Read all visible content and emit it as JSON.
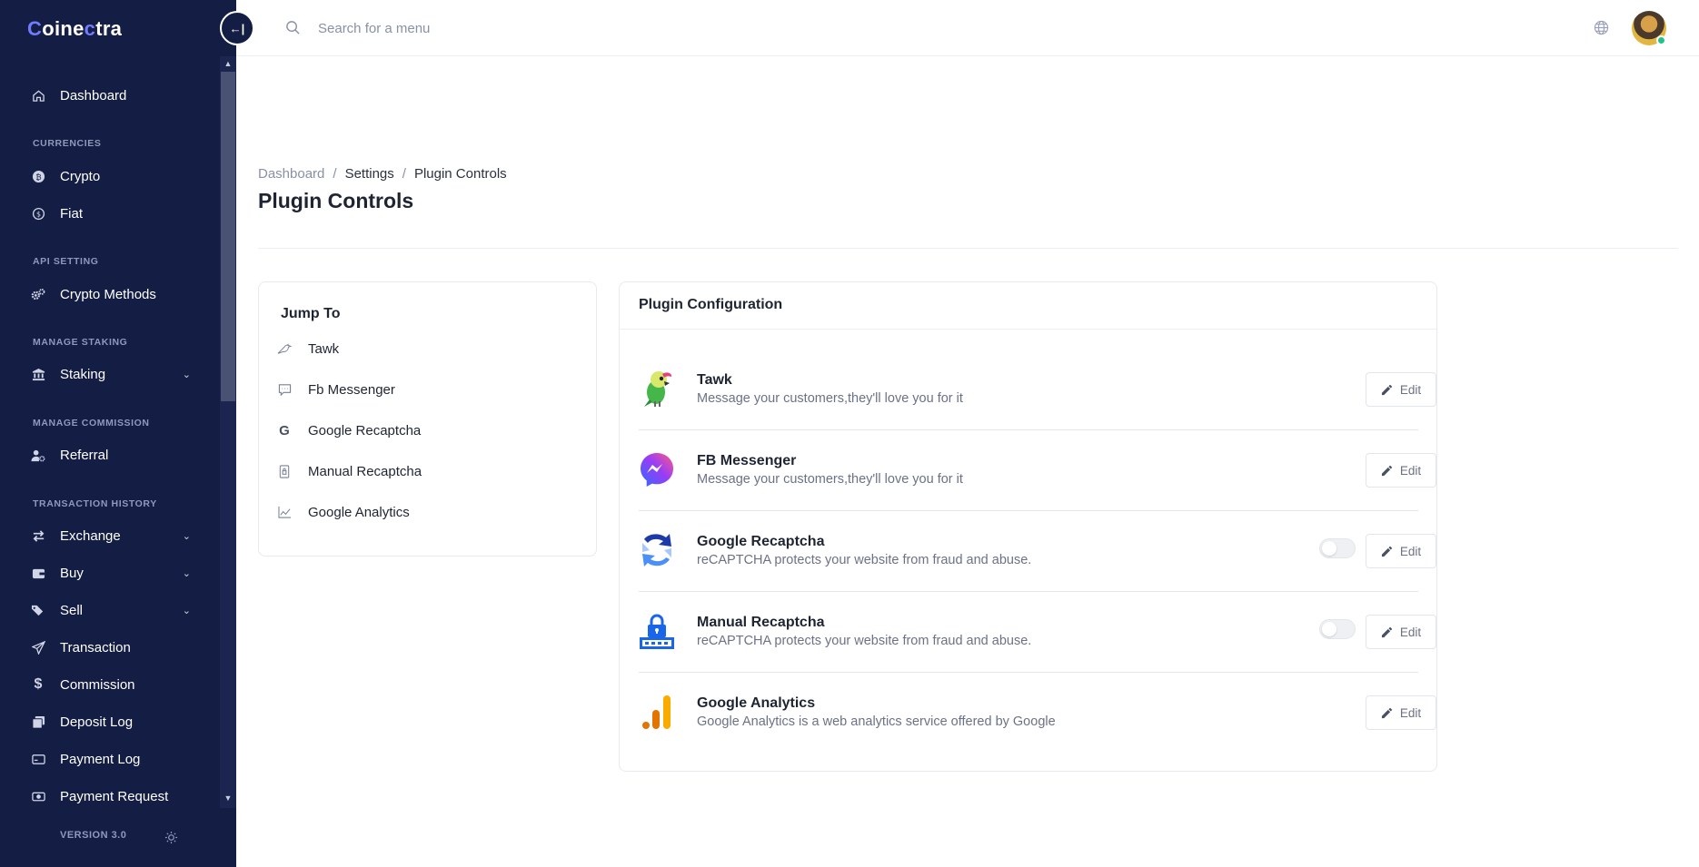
{
  "app": {
    "logo_first": "C",
    "logo_mid": "oine",
    "logo_accent": "c",
    "logo_last": "tra",
    "version": "VERSION 3.0"
  },
  "sidebar": {
    "dashboard": "Dashboard",
    "sections": {
      "currencies": "CURRENCIES",
      "api_setting": "API SETTING",
      "manage_staking": "MANAGE STAKING",
      "manage_commission": "MANAGE COMMISSION",
      "transaction_history": "TRANSACTION HISTORY"
    },
    "items": {
      "crypto": "Crypto",
      "fiat": "Fiat",
      "crypto_methods": "Crypto Methods",
      "staking": "Staking",
      "referral": "Referral",
      "exchange": "Exchange",
      "buy": "Buy",
      "sell": "Sell",
      "transaction": "Transaction",
      "commission": "Commission",
      "deposit_log": "Deposit Log",
      "payment_log": "Payment Log",
      "payment_request": "Payment Request"
    }
  },
  "topbar": {
    "search_placeholder": "Search for a menu"
  },
  "breadcrumb": {
    "home": "Dashboard",
    "settings": "Settings",
    "current": "Plugin Controls",
    "separator": "/"
  },
  "page": {
    "title": "Plugin Controls"
  },
  "jump": {
    "title": "Jump To",
    "items": [
      "Tawk",
      "Fb Messenger",
      "Google Recaptcha",
      "Manual Recaptcha",
      "Google Analytics"
    ]
  },
  "plugins": {
    "title": "Plugin Configuration",
    "edit_label": "Edit",
    "rows": [
      {
        "name": "Tawk",
        "desc": "Message your customers,they'll love you for it"
      },
      {
        "name": "FB Messenger",
        "desc": "Message your customers,they'll love you for it"
      },
      {
        "name": "Google Recaptcha",
        "desc": "reCAPTCHA protects your website from fraud and abuse."
      },
      {
        "name": "Manual Recaptcha",
        "desc": "reCAPTCHA protects your website from fraud and abuse."
      },
      {
        "name": "Google Analytics",
        "desc": "Google Analytics is a web analytics service offered by Google"
      }
    ]
  },
  "colors": {
    "sidebar_bg": "#141d43",
    "accent": "#6f7cff",
    "status_online": "#22c28e"
  }
}
